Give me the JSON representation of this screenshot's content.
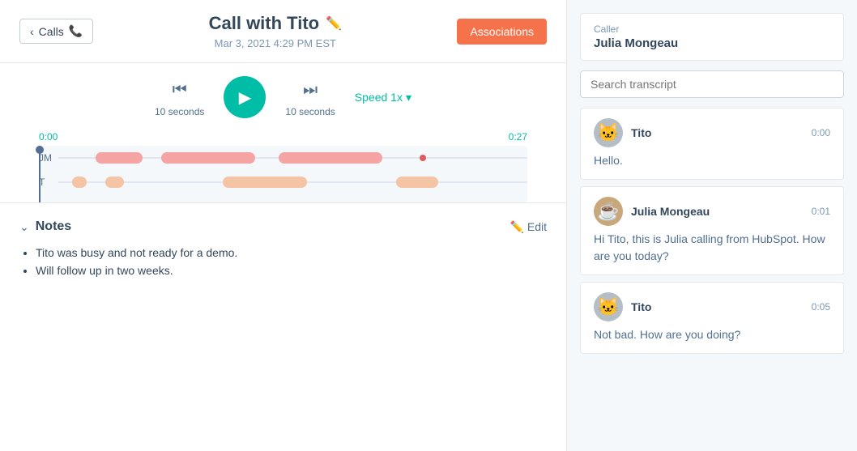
{
  "header": {
    "back_label": "Calls",
    "title": "Call with Tito",
    "date": "Mar 3, 2021 4:29 PM EST",
    "associations_btn": "Associations"
  },
  "audio_player": {
    "rewind_seconds": "10 seconds",
    "forward_seconds": "10 seconds",
    "speed_label": "Speed 1x",
    "time_start": "0:00",
    "time_end": "0:27"
  },
  "caller": {
    "label": "Caller",
    "name": "Julia Mongeau"
  },
  "search": {
    "placeholder": "Search transcript"
  },
  "notes": {
    "title": "Notes",
    "edit_label": "Edit",
    "items": [
      "Tito was busy and not ready for a demo.",
      "Will follow up in two weeks."
    ]
  },
  "transcript": [
    {
      "speaker": "Tito",
      "avatar_type": "cat",
      "timestamp": "0:00",
      "text": "Hello."
    },
    {
      "speaker": "Julia Mongeau",
      "avatar_type": "coffee",
      "timestamp": "0:01",
      "text": "Hi Tito, this is Julia calling from HubSpot. How are you today?"
    },
    {
      "speaker": "Tito",
      "avatar_type": "cat",
      "timestamp": "0:05",
      "text": "Not bad. How are you doing?"
    }
  ],
  "colors": {
    "primary_teal": "#00bda5",
    "accent_orange": "#f5724b",
    "text_dark": "#33475b",
    "text_mid": "#516f90",
    "text_light": "#7c98b6"
  }
}
